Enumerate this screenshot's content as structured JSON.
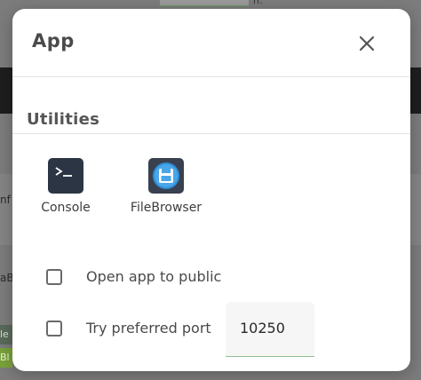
{
  "background": {
    "top_fragment": "n:",
    "edge_text_1": "nf",
    "edge_text_2": "aB",
    "edge_chip_1": "le",
    "edge_chip_2": "Bl"
  },
  "dialog": {
    "title": "App",
    "close_icon": "close-icon",
    "section_title": "Utilities",
    "utilities": [
      {
        "label": "Console",
        "icon": "terminal-icon",
        "color": "#2b3544"
      },
      {
        "label": "FileBrowser",
        "icon": "floppy-disk-icon",
        "color": "#394150"
      }
    ],
    "options": [
      {
        "label": "Open app to public",
        "checked": false
      },
      {
        "label": "Try preferred port",
        "checked": false
      }
    ],
    "port": {
      "value": "10250"
    }
  },
  "colors": {
    "dialog_bg": "#ffffff",
    "backdrop": "#7c7c7c",
    "accent_underline": "#8fbf8f"
  }
}
